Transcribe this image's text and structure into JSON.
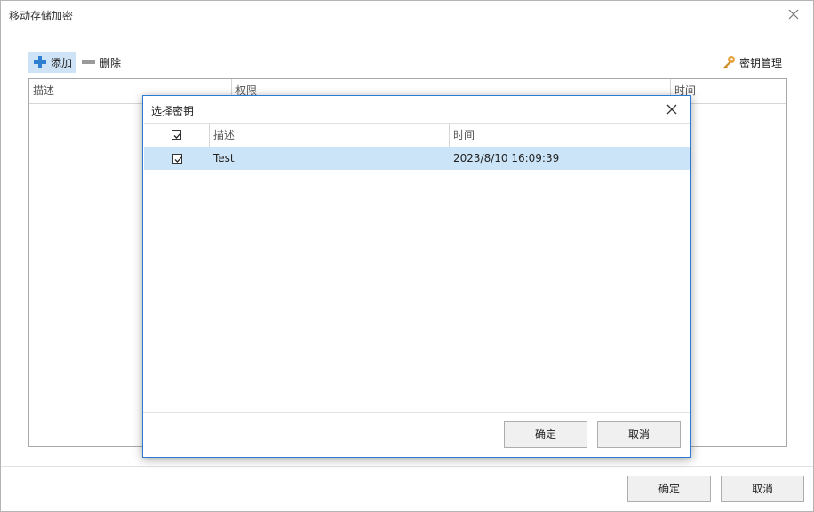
{
  "window": {
    "title": "移动存储加密"
  },
  "toolbar": {
    "add_label": "添加",
    "delete_label": "删除",
    "key_manage_label": "密钥管理"
  },
  "main_grid": {
    "columns": [
      "描述",
      "权限",
      "时间"
    ]
  },
  "footer": {
    "ok_label": "确定",
    "cancel_label": "取消"
  },
  "dialog": {
    "title": "选择密钥",
    "columns": [
      "描述",
      "时间"
    ],
    "rows": [
      {
        "checked": true,
        "description": "Test",
        "time": "2023/8/10 16:09:39"
      }
    ],
    "ok_label": "确定",
    "cancel_label": "取消"
  },
  "colors": {
    "accent": "#2b7bd0",
    "row_selected": "#cce4f7",
    "add_plus": "#2f7fd1",
    "key": "#e6a23c"
  },
  "icons": [
    "close-icon",
    "plus-icon",
    "minus-icon",
    "key-icon",
    "check-icon"
  ]
}
